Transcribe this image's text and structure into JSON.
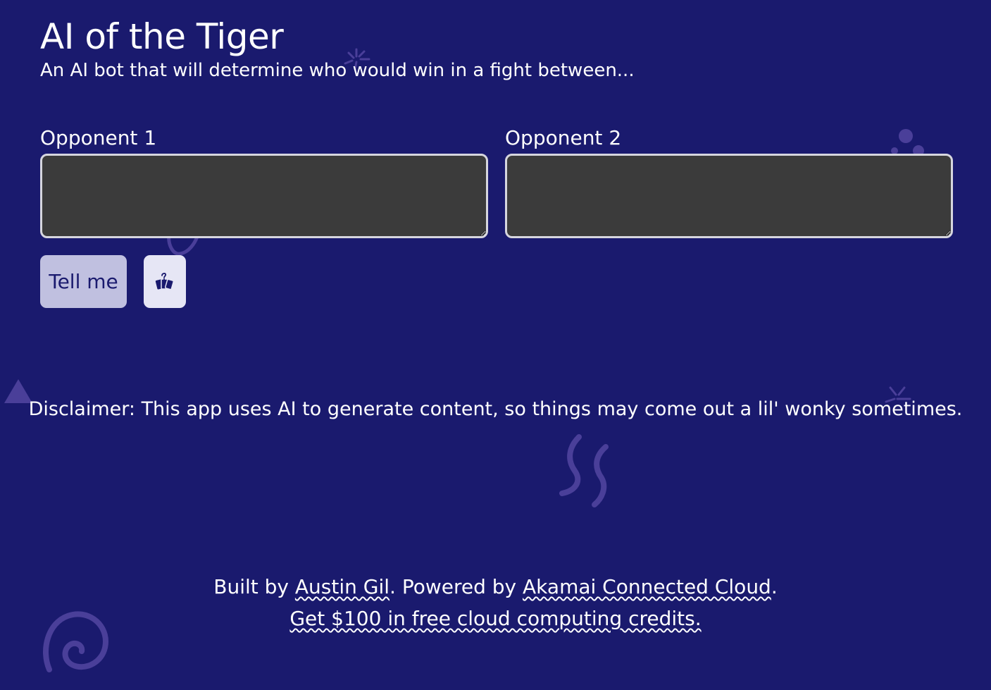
{
  "header": {
    "title": "AI of the Tiger",
    "subtitle": "An AI bot that will determine who would win in a fight between..."
  },
  "form": {
    "opponent1_label": "Opponent 1",
    "opponent1_value": "",
    "opponent2_label": "Opponent 2",
    "opponent2_value": "",
    "submit_label": "Tell me",
    "random_icon": "random-cards-icon"
  },
  "disclaimer": "Disclaimer: This app uses AI to generate content, so things may come out a lil' wonky sometimes.",
  "footer": {
    "built_by_prefix": "Built by ",
    "author_link": "Austin Gil",
    "powered_by_text": ". Powered by ",
    "provider_link": "Akamai Connected Cloud",
    "period": ".",
    "credits_link": "Get $100 in free cloud computing credits."
  },
  "colors": {
    "background": "#1a1a6e",
    "decoration": "#4a3f99",
    "textarea_bg": "#3b3b3b",
    "button_primary": "#c0c0e0",
    "button_secondary": "#e6e6f5"
  }
}
